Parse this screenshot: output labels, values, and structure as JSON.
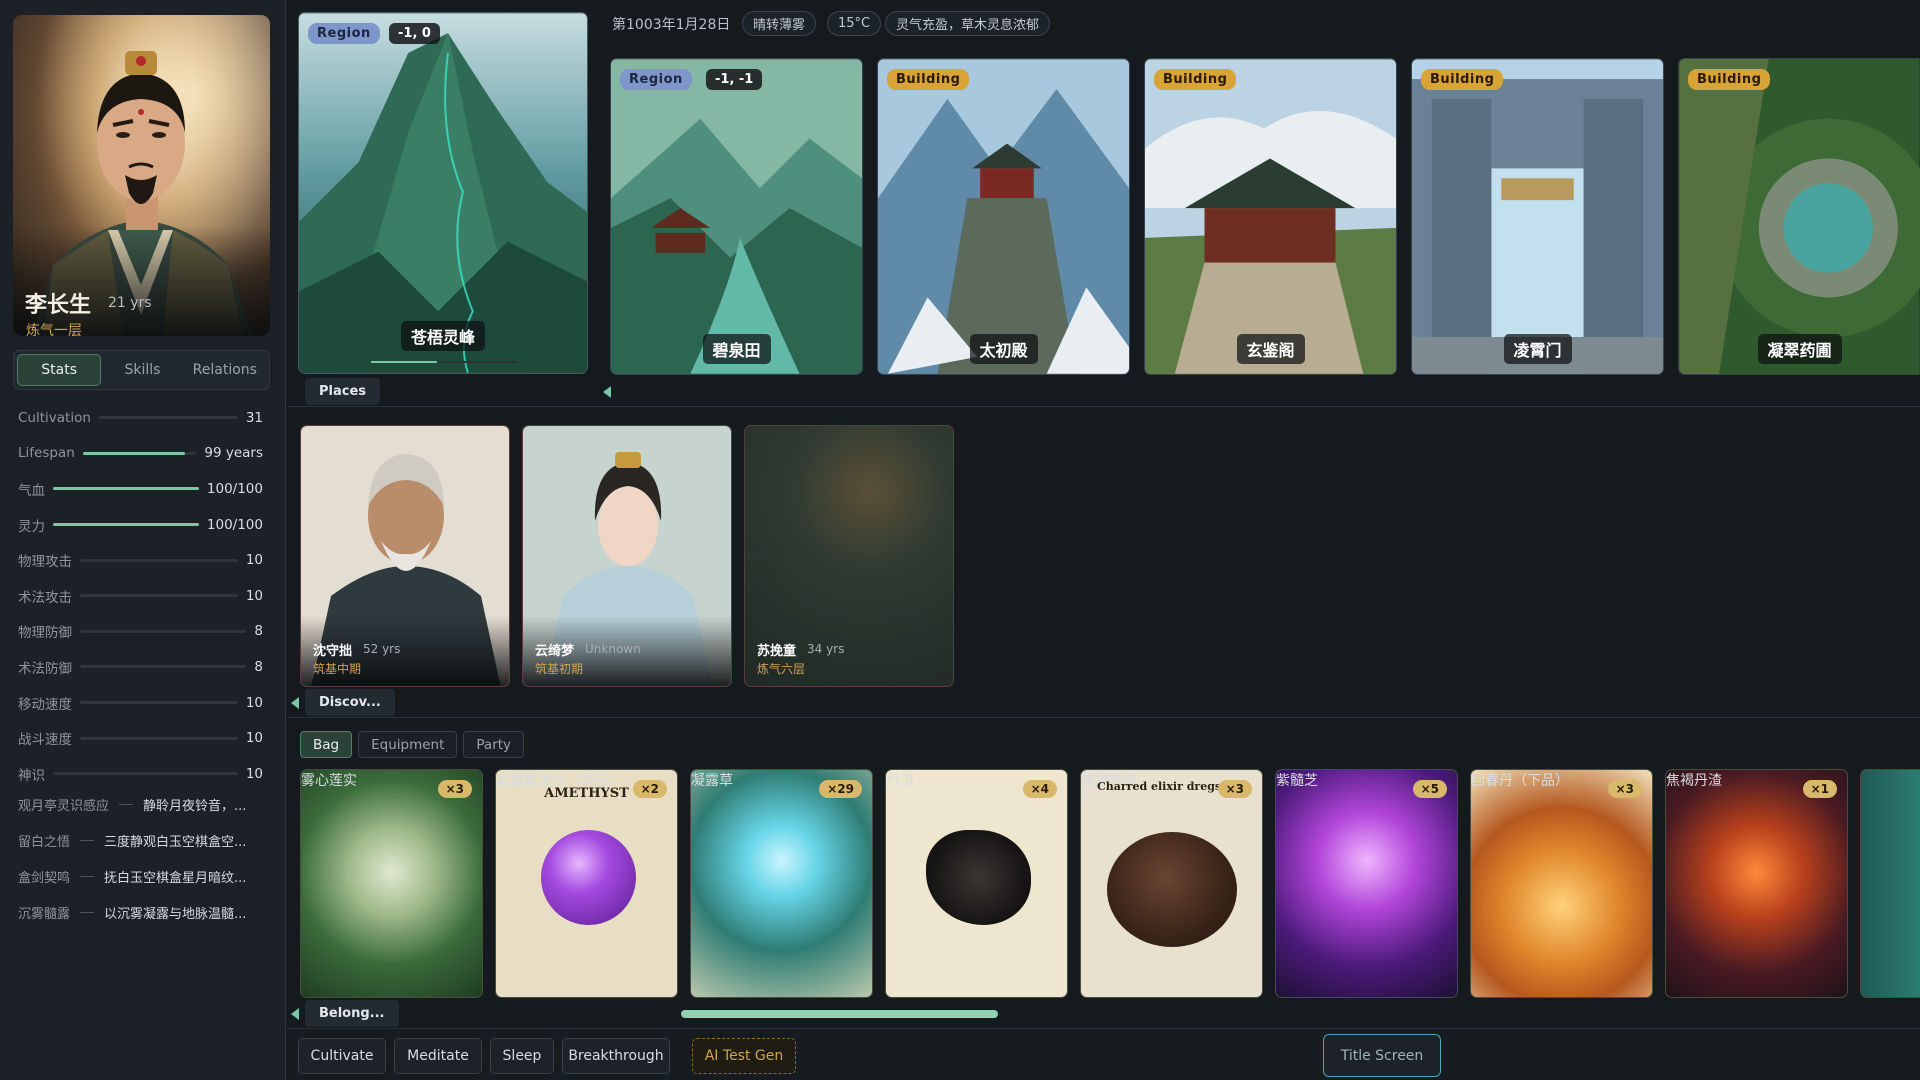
{
  "player": {
    "name": "李长生",
    "age": "21 yrs",
    "realm": "炼气一层"
  },
  "tabs": [
    "Stats",
    "Skills",
    "Relations"
  ],
  "stats": [
    {
      "label": "Cultivation",
      "value": "31",
      "fill": null
    },
    {
      "label": "Lifespan",
      "value": "99 years",
      "fill": 0.9
    },
    {
      "label": "气血",
      "value": "100/100",
      "fill": 1.0
    },
    {
      "label": "灵力",
      "value": "100/100",
      "fill": 1.0
    },
    {
      "label": "物理攻击",
      "value": "10",
      "fill": null
    },
    {
      "label": "术法攻击",
      "value": "10",
      "fill": null
    },
    {
      "label": "物理防御",
      "value": "8",
      "fill": null
    },
    {
      "label": "术法防御",
      "value": "8",
      "fill": null
    },
    {
      "label": "移动速度",
      "value": "10",
      "fill": null
    },
    {
      "label": "战斗速度",
      "value": "10",
      "fill": null
    },
    {
      "label": "神识",
      "value": "10",
      "fill": null
    }
  ],
  "lore": [
    {
      "k": "观月亭灵识感应",
      "v": "静聆月夜铃音，..."
    },
    {
      "k": "留白之悟",
      "v": "三度静观白玉空棋盒空..."
    },
    {
      "k": "盒剑契鸣",
      "v": "抚白玉空棋盒星月暗纹..."
    },
    {
      "k": "沉雾髓露",
      "v": "以沉雾凝露与地脉温髓..."
    }
  ],
  "header": {
    "date": "第1003年1月28日",
    "weather": "晴转薄雾",
    "temp": "15°C",
    "note": "灵气充盈，草木灵息浓郁"
  },
  "current_region": {
    "badge": "Region",
    "coord": "-1, 0",
    "name": "苍梧灵峰"
  },
  "places": [
    {
      "badge": "Region",
      "coord": "-1, -1",
      "name": "碧泉田"
    },
    {
      "badge": "Building",
      "name": "太初殿"
    },
    {
      "badge": "Building",
      "name": "玄鉴阁"
    },
    {
      "badge": "Building",
      "name": "凌霄门"
    },
    {
      "badge": "Building",
      "name": "凝翠药圃"
    }
  ],
  "section_labels": {
    "places": "Places",
    "discovered": "Discov...",
    "belongings": "Belong..."
  },
  "npcs": [
    {
      "name": "沈守拙",
      "age": "52 yrs",
      "realm": "筑基中期"
    },
    {
      "name": "云绮梦",
      "age": "Unknown",
      "realm": "筑基初期"
    },
    {
      "name": "苏挽童",
      "age": "34 yrs",
      "realm": "炼气六层"
    }
  ],
  "inventory_tabs": [
    "Bag",
    "Equipment",
    "Party"
  ],
  "items": [
    {
      "name": "雾心莲实",
      "qty": "×3"
    },
    {
      "name": "紫髓聚灵丹（中品）",
      "qty": "×2",
      "art_text": "AMETHYST"
    },
    {
      "name": "凝露草",
      "qty": "×29"
    },
    {
      "name": "丹渣",
      "qty": "×4"
    },
    {
      "name": "焦黑丹渣",
      "qty": "×3",
      "art_text": "Charred elixir dregs"
    },
    {
      "name": "紫髓芝",
      "qty": "×5"
    },
    {
      "name": "回春丹（下品）",
      "qty": "×3"
    },
    {
      "name": "焦褐丹渣",
      "qty": "×1"
    }
  ],
  "actions": [
    "Cultivate",
    "Meditate",
    "Sleep",
    "Breakthrough",
    "AI Test Gen"
  ],
  "title_screen": "Title Screen",
  "colors": {
    "accent": "#7cc7a5",
    "region_badge": "#7e96c9",
    "building_badge": "#d9a437",
    "realm_text": "#d0a552"
  }
}
